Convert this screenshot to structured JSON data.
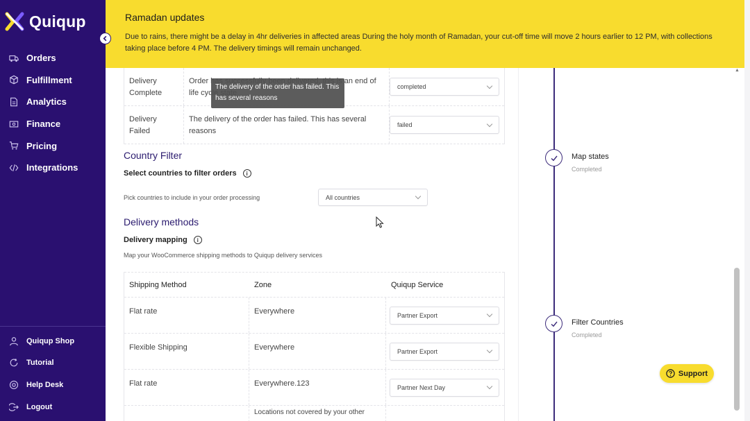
{
  "brand": {
    "name": "Quiqup"
  },
  "sidebar": {
    "items": [
      {
        "label": "Orders",
        "icon": "truck-icon"
      },
      {
        "label": "Fulfillment",
        "icon": "box-icon"
      },
      {
        "label": "Analytics",
        "icon": "document-icon"
      },
      {
        "label": "Finance",
        "icon": "money-icon"
      },
      {
        "label": "Pricing",
        "icon": "cart-icon"
      },
      {
        "label": "Integrations",
        "icon": "code-icon"
      }
    ],
    "bottom": [
      {
        "label": "Quiqup Shop",
        "icon": "user-icon"
      },
      {
        "label": "Tutorial",
        "icon": "refresh-icon"
      },
      {
        "label": "Help Desk",
        "icon": "lifebuoy-icon"
      },
      {
        "label": "Logout",
        "icon": "logout-icon"
      }
    ]
  },
  "banner": {
    "title": "Ramadan updates",
    "text": "Due to rains, there might be a delay in 4hr deliveries in affected areas During the holy month of Ramadan, your cut-off time will move 2 hours earlier to 12 PM, with collections taking place before 4 PM. The delivery timings will remain unchanged."
  },
  "states": [
    {
      "name": "Delivery Complete",
      "description": "Order has successfully been delivered, this is an end of life cycle state",
      "value": "completed"
    },
    {
      "name": "Delivery Failed",
      "description": "The delivery of the order has failed. This has several reasons",
      "value": "failed"
    }
  ],
  "tooltip": {
    "text": "The delivery of the order has failed. This has several reasons"
  },
  "country_filter": {
    "heading": "Country Filter",
    "subheading": "Select countries to filter orders",
    "hint": "Pick countries to include in your order processing",
    "selected": "All countries"
  },
  "delivery_methods": {
    "heading": "Delivery methods",
    "subheading": "Delivery mapping",
    "hint": "Map your WooCommerce shipping methods to Quiqup delivery services",
    "columns": [
      "Shipping Method",
      "Zone",
      "Quiqup Service"
    ],
    "rows": [
      {
        "method": "Flat rate",
        "zone": "Everywhere",
        "service": "Partner Export"
      },
      {
        "method": "Flexible Shipping",
        "zone": "Everywhere",
        "service": "Partner Export"
      },
      {
        "method": "Flat rate",
        "zone": "Everywhere.123",
        "service": "Partner Next Day"
      },
      {
        "method": "",
        "zone": "Locations not covered by your other",
        "service": ""
      }
    ]
  },
  "progress": {
    "steps": [
      {
        "title": "Map states",
        "status": "Completed"
      },
      {
        "title": "Filter Countries",
        "status": "Completed"
      }
    ]
  },
  "support": {
    "label": "Support"
  },
  "colors": {
    "sidebar": "#2a1070",
    "banner": "#f8dc2e",
    "accent": "#3b2a7a"
  }
}
